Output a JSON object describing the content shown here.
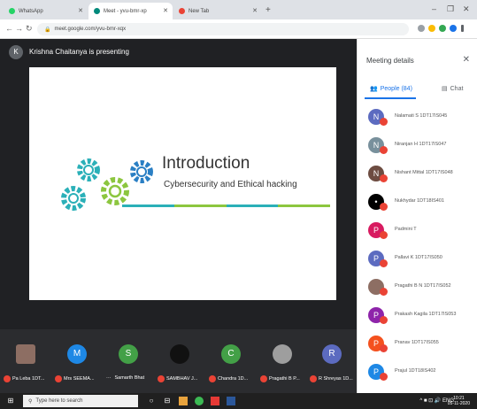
{
  "browser": {
    "tabs": [
      {
        "label": "WhatsApp",
        "fav_color": "#25d366",
        "active": false
      },
      {
        "label": "Meet - yvu-bmr-xp",
        "fav_color": "#00897b",
        "active": true
      },
      {
        "label": "New Tab",
        "fav_color": "#ea4335",
        "active": false
      }
    ],
    "new_tab": "+",
    "window_controls": [
      "–",
      "❐",
      "✕"
    ],
    "address": "meet.google.com/yvu-bmr-xqx"
  },
  "meet": {
    "presenter_initial": "K",
    "presenter_text": "Krishna Chaitanya is presenting",
    "slide": {
      "title": "Introduction",
      "subtitle": "Cybersecurity and Ethical hacking",
      "line_colors": [
        "#2bb0b8",
        "#8cc63f",
        "#2bb0b8",
        "#8cc63f"
      ]
    },
    "participants": [
      {
        "name": "Pa Leba 1DT...",
        "initial": "",
        "color": "#8d6e63",
        "photo": true
      },
      {
        "name": "Mrs SEEMA...",
        "initial": "M",
        "color": "#1e88e5",
        "photo": false
      },
      {
        "name": "Samarth Bhat",
        "initial": "S",
        "color": "#43a047",
        "photo": false,
        "muted_label": "···"
      },
      {
        "name": "SAMBHAV J...",
        "initial": "",
        "color": "#111111",
        "photo": true
      },
      {
        "name": "Chandra 1D...",
        "initial": "C",
        "color": "#43a047",
        "photo": false
      },
      {
        "name": "Pragathi B P...",
        "initial": "",
        "color": "#9e9e9e",
        "photo": true
      },
      {
        "name": "R Shreyas 1D...",
        "initial": "R",
        "color": "#5c6bc0",
        "photo": false
      }
    ]
  },
  "panel": {
    "title": "Meeting details",
    "close": "✕",
    "tab_people": "People (84)",
    "tab_chat": "Chat",
    "people": [
      {
        "name": "Nalamati S 1DT17IS045",
        "initial": "N",
        "color": "#5c6bc0"
      },
      {
        "name": "Niranjan H 1DT17IS047",
        "initial": "N",
        "color": "#78909c"
      },
      {
        "name": "Nishant Mittal 1DT17IS048",
        "initial": "N",
        "color": "#6d4c41"
      },
      {
        "name": "Nukhydar 1DT18IS401",
        "initial": "•",
        "color": "#000000"
      },
      {
        "name": "Padmini T",
        "initial": "P",
        "color": "#d81b60"
      },
      {
        "name": "Pallavi K 1DT17IS050",
        "initial": "P",
        "color": "#5c6bc0"
      },
      {
        "name": "Pragathi B N 1DT17IS052",
        "initial": "",
        "color": "#8d6e63"
      },
      {
        "name": "Prakash Kagila 1DT17IS053",
        "initial": "P",
        "color": "#8e24aa"
      },
      {
        "name": "Pranav 1DT17IS055",
        "initial": "P",
        "color": "#f4511e"
      },
      {
        "name": "Prajul 1DT18IS402",
        "initial": "P",
        "color": "#1e88e5"
      }
    ]
  },
  "taskbar": {
    "start": "⊞",
    "search_placeholder": "Type here to search",
    "tray": "^ ■ ⊡ 🔊 ENG",
    "time": "10:21",
    "date": "05-11-2020"
  }
}
